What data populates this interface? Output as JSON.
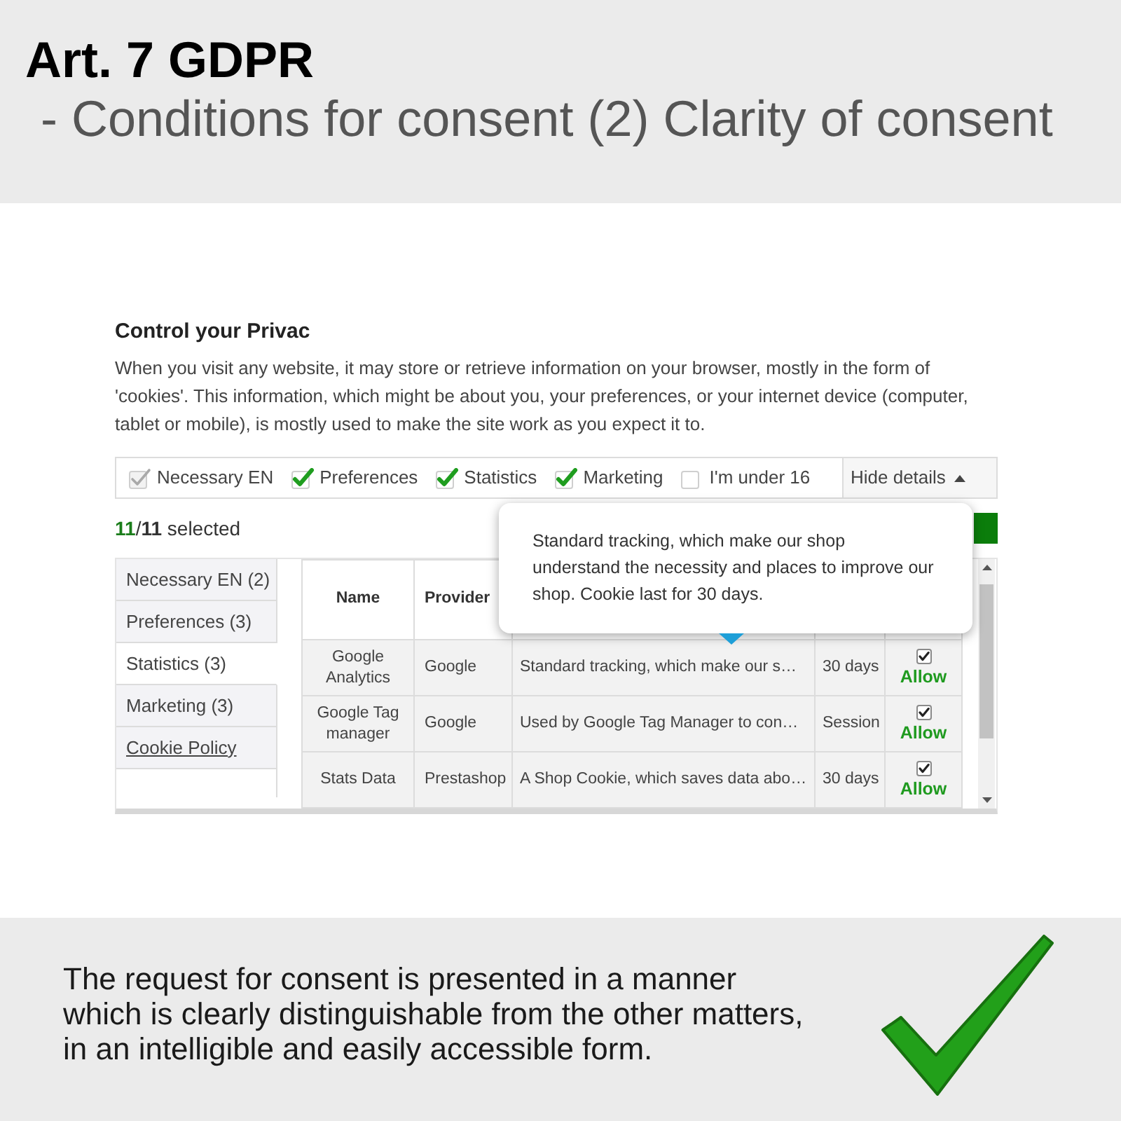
{
  "header": {
    "title": "Art. 7 GDPR",
    "subtitle": "- Conditions for consent (2) Clarity of consent"
  },
  "privacy_widget": {
    "title": "Control your Privac",
    "intro": "When you visit any website, it may store or retrieve information on your browser, mostly in the form of 'cookies'. This information, which might be about you, your preferences, or your internet device (computer, tablet or mobile), is mostly used to make the site work as you expect it to.",
    "categories": [
      {
        "label": "Necessary EN",
        "checked": true,
        "disabled": true
      },
      {
        "label": "Preferences",
        "checked": true,
        "disabled": false
      },
      {
        "label": "Statistics",
        "checked": true,
        "disabled": false
      },
      {
        "label": "Marketing",
        "checked": true,
        "disabled": false
      },
      {
        "label": "I'm under 16",
        "checked": false,
        "disabled": false
      }
    ],
    "details_toggle": {
      "label": "Hide details",
      "expanded": true
    },
    "selection_summary": "**11**/**11** selected",
    "tabs": [
      {
        "kind": "tab",
        "label": "Necessary EN (2)",
        "selected": false
      },
      {
        "kind": "tab",
        "label": "Preferences (3)",
        "selected": false
      },
      {
        "kind": "tab",
        "label": "Statistics (3)",
        "selected": true
      },
      {
        "kind": "tab",
        "label": "Marketing (3)",
        "selected": false
      },
      {
        "kind": "link",
        "label": "Cookie Policy",
        "selected": false
      }
    ],
    "table": {
      "columns": [
        "Name",
        "Provider"
      ],
      "rows": [
        {
          "name": "Google Analytics",
          "provider": "Google",
          "purpose": "Standard tracking, which make our s…",
          "expiry": "30 days",
          "consent": {
            "checked": true,
            "label": "Allow"
          }
        },
        {
          "name": "Google Tag manager",
          "provider": "Google",
          "purpose": "Used by Google Tag Manager to con…",
          "expiry": "Session",
          "consent": {
            "checked": true,
            "label": "Allow"
          }
        },
        {
          "name": "Stats Data",
          "provider": "Prestashop",
          "purpose": "A Shop Cookie, which saves data abo…",
          "expiry": "30 days",
          "consent": {
            "checked": true,
            "label": "Allow"
          }
        }
      ]
    },
    "tooltip": "Standard tracking, which make our shop understand the necessity and places to improve our shop. Cookie last for 30 days."
  },
  "note": {
    "text": "The request for consent is presented in a manner which is clearly distinguishable from the other matters, in an intelligible and easily accessible form."
  }
}
